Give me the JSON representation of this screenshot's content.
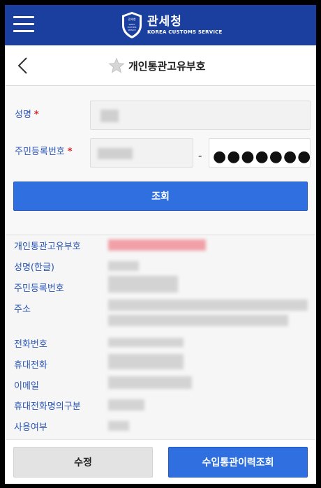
{
  "header": {
    "logo_kr": "관세청",
    "logo_en": "KOREA CUSTOMS SERVICE",
    "emblem_text_kr": "관세청",
    "emblem_text_en": "KOREA CUSTOMS SERVICE",
    "icons": {
      "menu": "hamburger-menu-icon",
      "emblem": "customs-shield-emblem"
    },
    "bg_color": "#1a3f9e"
  },
  "titlebar": {
    "title": "개인통관고유부호",
    "icons": {
      "back": "chevron-left-icon",
      "favorite": "star-icon"
    }
  },
  "form": {
    "name_label": "성명",
    "rrn_label": "주민등록번호",
    "required_mark": "*",
    "rrn_separator": "-",
    "rrn_back_masked": "●●●●●●●",
    "search_label": "조회"
  },
  "result": {
    "labels": [
      "개인통관고유부호",
      "성명(한글)",
      "주민등록번호",
      "주소",
      "전화번호",
      "휴대전화",
      "이메일",
      "휴대전화명의구분",
      "사용여부"
    ]
  },
  "footer": {
    "edit_label": "수정",
    "history_label": "수입통관이력조회"
  },
  "colors": {
    "accent": "#2f6fe0",
    "label_blue": "#2b56b8",
    "required_red": "#d9262c"
  }
}
